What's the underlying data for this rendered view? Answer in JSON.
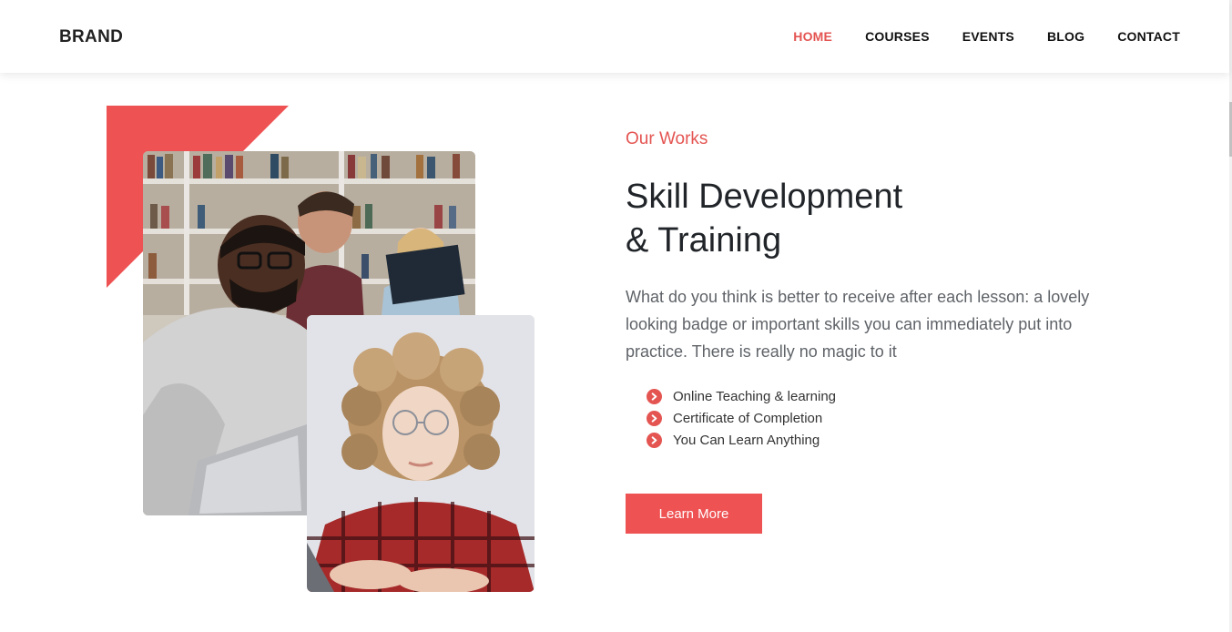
{
  "header": {
    "brand": "BRAND",
    "nav": [
      {
        "label": "HOME",
        "active": true
      },
      {
        "label": "COURSES",
        "active": false
      },
      {
        "label": "EVENTS",
        "active": false
      },
      {
        "label": "BLOG",
        "active": false
      },
      {
        "label": "CONTACT",
        "active": false
      }
    ]
  },
  "section": {
    "eyebrow": "Our Works",
    "title_line1": "Skill Development",
    "title_line2": "& Training",
    "description": "What do you think is better to receive after each lesson: a lovely looking badge or important skills you can immediately put into practice. There is really no magic to it",
    "features": [
      "Online Teaching & learning",
      "Certificate of Completion",
      "You Can Learn Anything"
    ],
    "cta_label": "Learn More"
  },
  "colors": {
    "accent": "#ee5253",
    "nav_active": "#e45552",
    "heading": "#212529",
    "body_text": "#5f6368"
  },
  "icons": {
    "feature_bullet": "chevron-right-circle-icon"
  }
}
